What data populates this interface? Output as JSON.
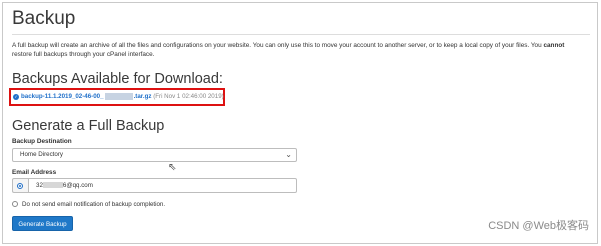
{
  "page": {
    "title": "Backup",
    "description_part1": "A full backup will create an archive of all the files and configurations on your website. You can only use this to move your account to another server, or to keep a local copy of your files. You ",
    "description_bold": "cannot",
    "description_part2": " restore full backups through your cPanel interface."
  },
  "available": {
    "heading": "Backups Available for Download:",
    "file_prefix": "backup-11.1.2019_02-46-00_",
    "file_suffix": ".tar.gz",
    "file_date": "(Fri Nov 1 02:46:00 2019)"
  },
  "generate": {
    "heading": "Generate a Full Backup",
    "destination_label": "Backup Destination",
    "destination_value": "Home Directory",
    "email_label": "Email Address",
    "email_prefix": "32",
    "email_suffix": "6@qq.com",
    "no_email_label": "Do not send email notification of backup completion.",
    "button_label": "Generate Backup"
  },
  "watermark": "CSDN @Web极客码"
}
